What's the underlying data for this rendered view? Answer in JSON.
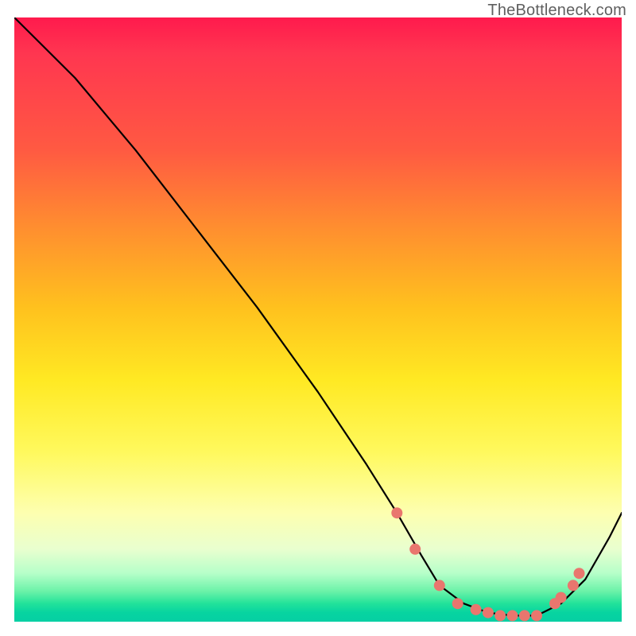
{
  "watermark": "TheBottleneck.com",
  "chart_data": {
    "type": "line",
    "title": "",
    "xlabel": "",
    "ylabel": "",
    "xlim": [
      0,
      100
    ],
    "ylim": [
      0,
      100
    ],
    "grid": false,
    "series": [
      {
        "name": "bottleneck-curve",
        "x": [
          0,
          4,
          10,
          20,
          30,
          40,
          50,
          58,
          63,
          67,
          70,
          74,
          78,
          82,
          86,
          90,
          94,
          98,
          100
        ],
        "y": [
          100,
          96,
          90,
          78,
          65,
          52,
          38,
          26,
          18,
          11,
          6,
          3,
          1.5,
          1,
          1,
          3,
          7,
          14,
          18
        ]
      }
    ],
    "markers": {
      "name": "highlight-dots",
      "x": [
        63,
        66,
        70,
        73,
        76,
        78,
        80,
        82,
        84,
        86,
        89,
        90,
        92,
        93
      ],
      "y": [
        18,
        12,
        6,
        3,
        2,
        1.5,
        1,
        1,
        1,
        1,
        3,
        4,
        6,
        8
      ]
    },
    "background_gradient": {
      "top": "#ff1a4d",
      "mid": "#ffe923",
      "bottom": "#06cfa4"
    }
  }
}
